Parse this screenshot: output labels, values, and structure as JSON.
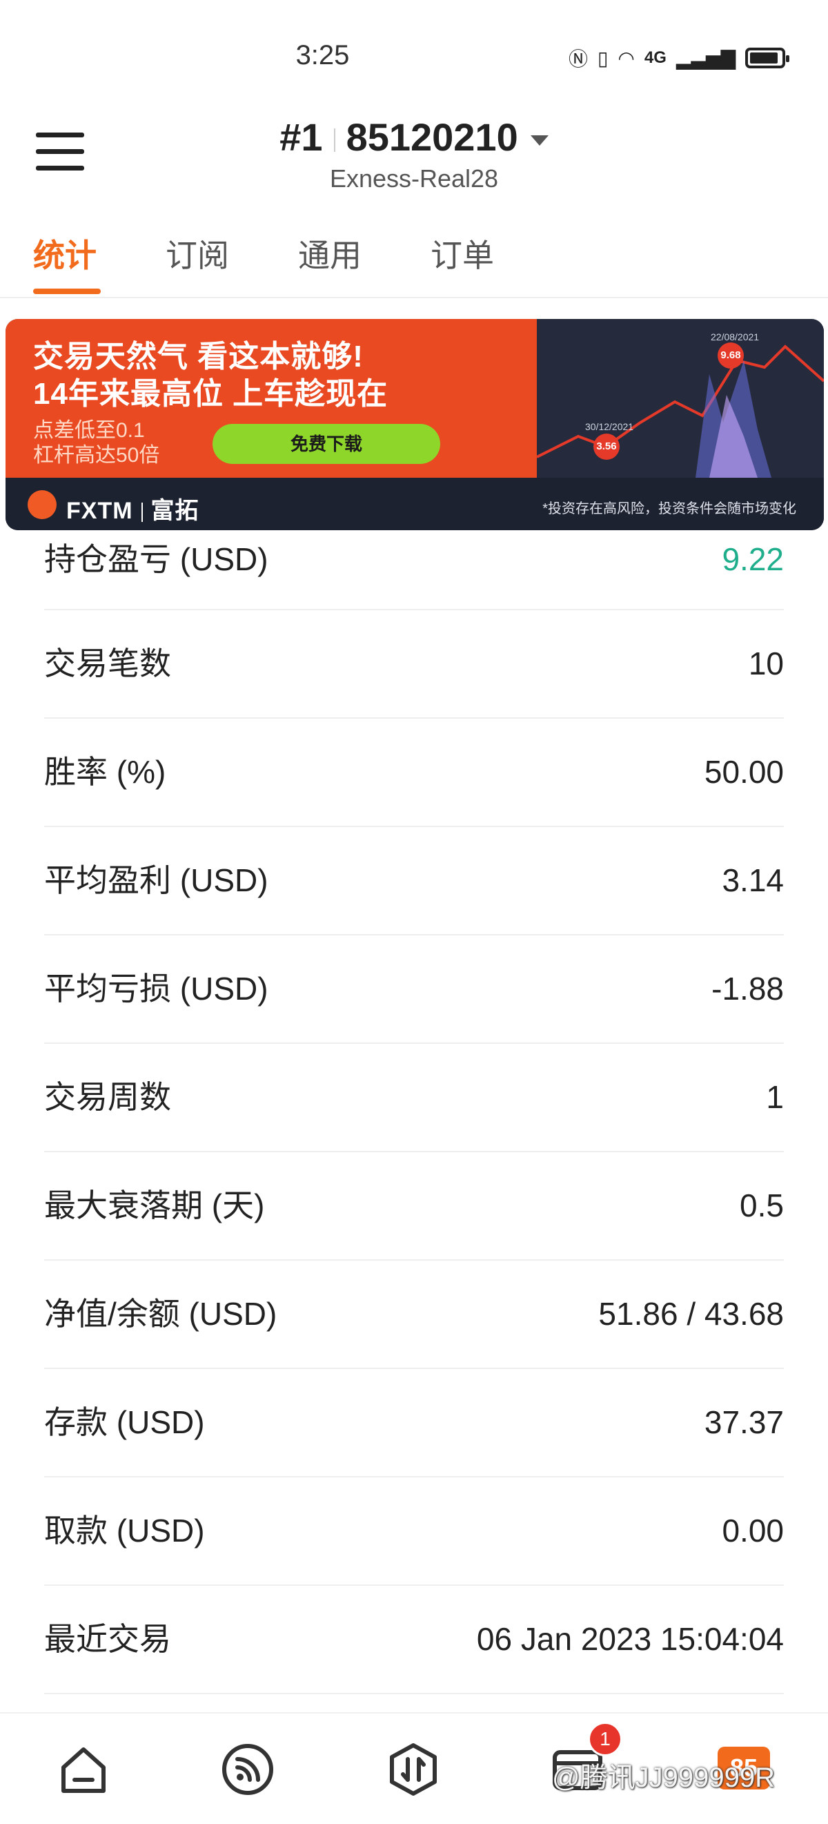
{
  "status_bar": {
    "time": "3:25",
    "icons": [
      "nfc-icon",
      "vibrate-icon",
      "wifi-icon",
      "cell-signal-icon",
      "battery-icon"
    ],
    "network": "4G",
    "battery_level": 0.9
  },
  "header": {
    "account_prefix": "#1",
    "account_number": "85120210",
    "server": "Exness-Real28"
  },
  "tabs": [
    {
      "label": "统计",
      "active": true
    },
    {
      "label": "订阅",
      "active": false
    },
    {
      "label": "通用",
      "active": false
    },
    {
      "label": "订单",
      "active": false
    }
  ],
  "ad": {
    "title_line1": "交易天然气 看这本就够!",
    "title_line2": "14年来最高位 上车趁现在",
    "sub_line1": "点差低至0.1",
    "sub_line2": "杠杆高达50倍",
    "button": "免费下载",
    "brand": "FXTM",
    "brand_cn": "富拓",
    "disclaimer": "*投资存在高风险，投资条件会随市场变化",
    "date_high": "22/08/2021",
    "value_high": "9.68",
    "date_low": "30/12/2021",
    "value_low": "3.56",
    "accent_color": "#e94a22"
  },
  "stats": {
    "partial_row": {
      "label": "持仓盈亏 (USD)",
      "value": "9.22"
    },
    "rows": [
      {
        "label": "交易笔数",
        "value": "10"
      },
      {
        "label": "胜率 (%)",
        "value": "50.00"
      },
      {
        "label": "平均盈利 (USD)",
        "value": "3.14"
      },
      {
        "label": "平均亏损 (USD)",
        "value": "-1.88"
      },
      {
        "label": "交易周数",
        "value": "1"
      },
      {
        "label": "最大衰落期 (天)",
        "value": "0.5"
      },
      {
        "label": "净值/余额 (USD)",
        "value": "51.86 / 43.68"
      },
      {
        "label": "存款 (USD)",
        "value": "37.37"
      },
      {
        "label": "取款 (USD)",
        "value": "0.00"
      },
      {
        "label": "最近交易",
        "value": "06 Jan 2023 15:04:04"
      }
    ]
  },
  "bottom_nav": {
    "items": [
      "home-icon",
      "signal-icon",
      "trade-icon",
      "orders-icon",
      "promo-icon"
    ],
    "orders_badge": "1",
    "promo_label": "85",
    "watermark": "@腾讯JJ999999R"
  },
  "colors": {
    "accent": "#f26a1b",
    "positive": "#1fae8b"
  }
}
